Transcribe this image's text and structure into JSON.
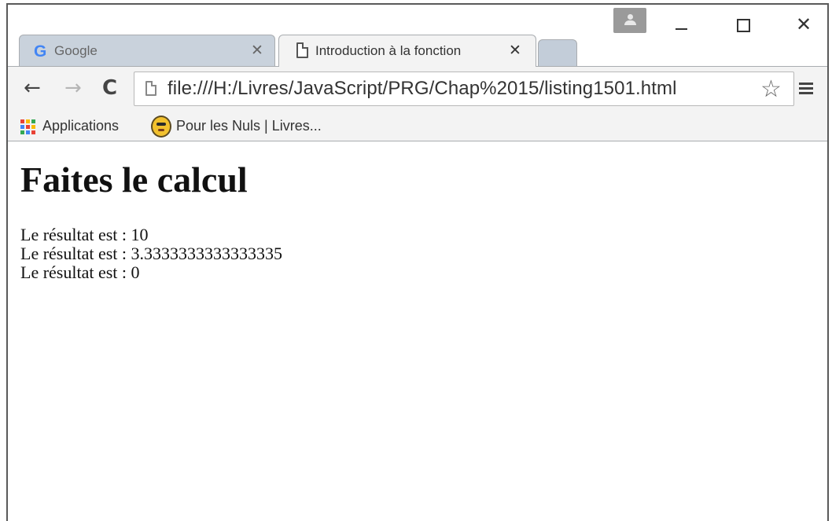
{
  "window": {
    "controls": {
      "minimize_icon": "minimize-icon",
      "maximize_icon": "maximize-icon",
      "close_symbol": "✕"
    }
  },
  "tabs": [
    {
      "title": "Google",
      "icon": "G",
      "close": "✕",
      "active": false
    },
    {
      "title": "Introduction à la fonction",
      "icon": "page-icon",
      "close": "✕",
      "active": true
    }
  ],
  "toolbar": {
    "back": "←",
    "forward": "→",
    "reload": "C",
    "url": "file:///H:/Livres/JavaScript/PRG/Chap%2015/listing1501.html",
    "star": "☆"
  },
  "bookmarks": [
    {
      "label": "Applications",
      "icon": "apps-grid-icon"
    },
    {
      "label": "Pour les Nuls | Livres...",
      "icon": "pour-les-nuls-icon"
    }
  ],
  "page": {
    "heading": "Faites le calcul",
    "results": [
      "Le résultat est : 10",
      "Le résultat est : 3.3333333333333335",
      "Le résultat est : 0"
    ]
  },
  "colors": {
    "window_border": "#5a5a5a",
    "inactive_tab": "#c9d2dc",
    "toolbar_bg": "#f3f3f3",
    "google_blue": "#4285f4"
  }
}
